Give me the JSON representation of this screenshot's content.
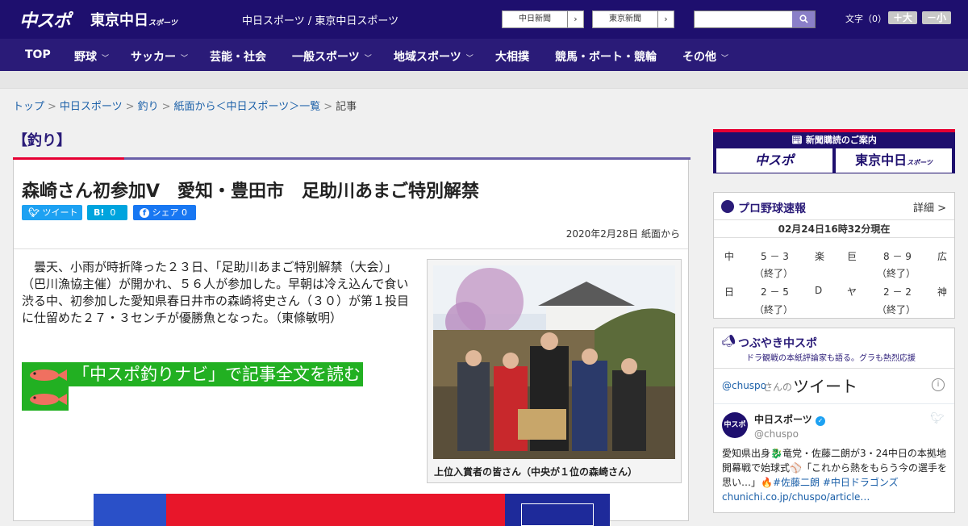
{
  "header": {
    "logo_main": "中スポ",
    "logo_tokyo": "東京中日",
    "logo_tokyo_sub": "スポーツ",
    "site_title": "中日スポーツ / 東京中日スポーツ",
    "paper_btn1": "中日新聞",
    "paper_btn2": "東京新聞",
    "btn_arrow": "›",
    "font_label": "文字（0）",
    "font_up": "＋大",
    "font_down": "－小"
  },
  "nav": [
    {
      "label": "TOP",
      "dropdown": false
    },
    {
      "label": "野球",
      "dropdown": true
    },
    {
      "label": "サッカー",
      "dropdown": true
    },
    {
      "label": "芸能・社会",
      "dropdown": false
    },
    {
      "label": "一般スポーツ",
      "dropdown": true
    },
    {
      "label": "地域スポーツ",
      "dropdown": true
    },
    {
      "label": "大相撲",
      "dropdown": false
    },
    {
      "label": "競馬・ボート・競輪",
      "dropdown": false
    },
    {
      "label": "その他",
      "dropdown": true
    }
  ],
  "breadcrumb": [
    "トップ",
    "中日スポーツ",
    "釣り",
    "紙面から＜中日スポーツ＞一覧",
    "記事"
  ],
  "breadcrumb_sep": ">",
  "section_title": "【釣り】",
  "article": {
    "headline": "森崎さん初参加V　愛知・豊田市　足助川あまご特別解禁",
    "share_tweet": "ツイート",
    "share_hatena": "B!",
    "share_hatena_count": "0",
    "share_fb": "シェア",
    "share_fb_count": "0",
    "date": "2020年2月28日 紙面から",
    "body": "　曇天、小雨が時折降った２３日、「足助川あまご特別解禁（大会）」（巴川漁協主催）が開かれ、５６人が参加した。早朝は冷え込んで食い渋る中、初参加した愛知県春日井市の森崎将史さん（３０）が第１投目に仕留めた２７・３センチが優勝魚となった。（東條敏明）",
    "navi_link": "「中スポ釣りナビ」で記事全文を読む",
    "photo_caption": "上位入賞者の皆さん（中央が１位の森崎さん）"
  },
  "sidebar": {
    "ad_title": "新聞購読のご案内",
    "ad_btn1": "中スポ",
    "ad_btn2": "東京中日",
    "ad_btn2_sub": "スポーツ",
    "baseball_title": "プロ野球速報",
    "baseball_more": "詳細 >",
    "baseball_stamp": "02月24日16時32分現在",
    "games": [
      {
        "home": "中",
        "score": "5 － 3",
        "away": "楽",
        "status": "（終了）"
      },
      {
        "home": "巨",
        "score": "8 － 9",
        "away": "広",
        "status": "（終了）"
      },
      {
        "home": "日",
        "score": "2 － 5",
        "away": "D",
        "status": "（終了）"
      },
      {
        "home": "ヤ",
        "score": "2 － 2",
        "away": "神",
        "status": "（終了）"
      }
    ],
    "tw_title": "つぶやき中スポ",
    "tw_sub": "ドラ観戦の本紙評論家も語る。グラも熱烈応援",
    "tw_header_user": "@chuspo",
    "tw_header_suffix": "さんの",
    "tw_header_word": "ツイート",
    "tw_name": "中日スポーツ",
    "tw_handle": "@chuspo",
    "tw_text": "愛知県出身🐉竜党・佐藤二朗が3・24中日の本拠地開幕戦で始球式⚾「これから熱をもらう今の選手を思い…」🔥",
    "tw_tags": "#佐藤二朗 #中日ドラゴンズ",
    "tw_link": "chunichi.co.jp/chuspo/article…"
  }
}
